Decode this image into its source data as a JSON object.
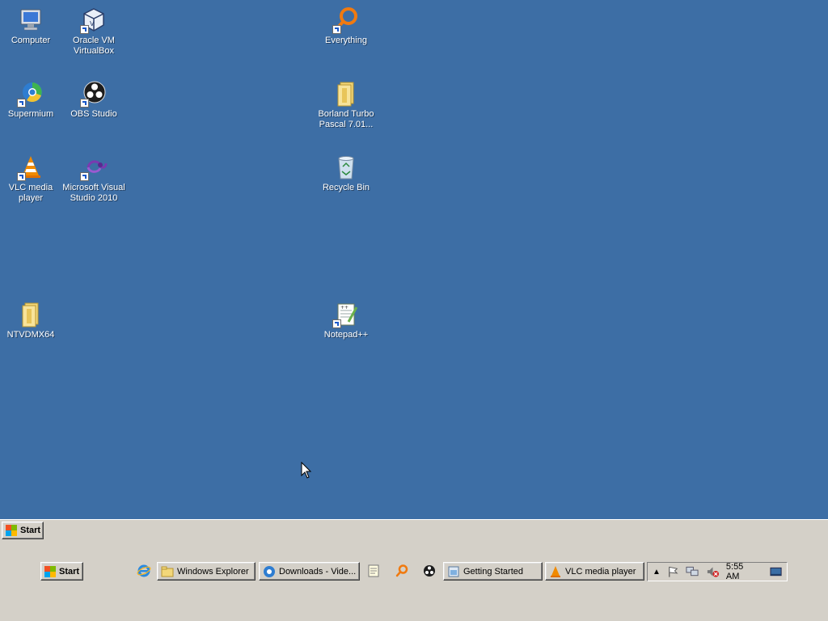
{
  "desktop": {
    "icons": {
      "computer": "Computer",
      "virtualbox": "Oracle VM VirtualBox",
      "everything": "Everything",
      "supermium": "Supermium",
      "obs": "OBS Studio",
      "borland": "Borland Turbo Pascal 7.01...",
      "vlc": "VLC media player",
      "msvs": "Microsoft Visual Studio 2010",
      "recycle": "Recycle Bin",
      "ntvdm": "NTVDMX64",
      "notepadpp": "Notepad++"
    }
  },
  "taskbar": {
    "start_top": "Start",
    "start_bottom": "Start",
    "tasks": {
      "explorer": "Windows Explorer",
      "downloads": "Downloads - Vide...",
      "getting_started": "Getting Started",
      "vlc": "VLC media player"
    },
    "tray": {
      "clock": "5:55 AM"
    }
  },
  "icons": {
    "computer": "monitor-icon",
    "virtualbox": "virtualbox-icon",
    "everything": "everything-search-icon",
    "supermium": "browser-icon",
    "obs": "obs-icon",
    "folder": "folder-icon",
    "vlc": "vlc-cone-icon",
    "msvs": "visual-studio-icon",
    "recycle": "recycle-bin-icon",
    "notepadpp": "notepad-plus-plus-icon"
  },
  "colors": {
    "desktop": "#3d6ea5",
    "taskbar": "#d4d0c8"
  }
}
